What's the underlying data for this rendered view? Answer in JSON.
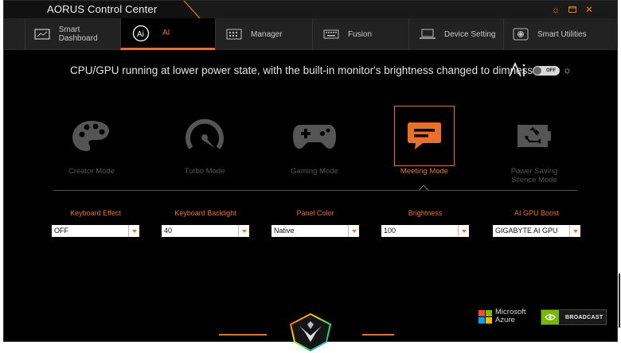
{
  "window": {
    "title": "AORUS Control Center"
  },
  "tabs": [
    {
      "label": "Smart Dashboard",
      "icon": "monitor-icon"
    },
    {
      "label": "AI",
      "icon": "ai-icon",
      "active": true
    },
    {
      "label": "Manager",
      "icon": "keyboard-grid-icon"
    },
    {
      "label": "Fusion",
      "icon": "keyboard-icon"
    },
    {
      "label": "Device Setting",
      "icon": "laptop-icon"
    },
    {
      "label": "Smart Utilities",
      "icon": "utilities-icon"
    }
  ],
  "description": "CPU/GPU running at lower power state, with the built-in monitor's brightness changed to dimness.",
  "ai_toggle": {
    "state": "OFF"
  },
  "modes": [
    {
      "label": "Creator Mode",
      "icon": "palette-icon"
    },
    {
      "label": "Turbo Mode",
      "icon": "speedometer-icon"
    },
    {
      "label": "Gaming Mode",
      "icon": "gamepad-icon"
    },
    {
      "label": "Meeting Mode",
      "icon": "chat-icon",
      "active": true
    },
    {
      "label": "Power Saving Silence Mode",
      "icon": "battery-recycle-icon"
    }
  ],
  "settings": [
    {
      "label": "Keyboard Effect",
      "value": "OFF"
    },
    {
      "label": "Keyboard Backlight",
      "value": "40"
    },
    {
      "label": "Panel Color",
      "value": "Native"
    },
    {
      "label": "Brightness",
      "value": "100"
    },
    {
      "label": "AI GPU Boost",
      "value": "GIGABYTE AI GPU"
    }
  ],
  "badges": {
    "microsoft": "Microsoft Azure",
    "nvidia": "BROADCAST"
  },
  "colors": {
    "accent": "#e8702a",
    "background": "#000000",
    "inactive": "#555555"
  }
}
